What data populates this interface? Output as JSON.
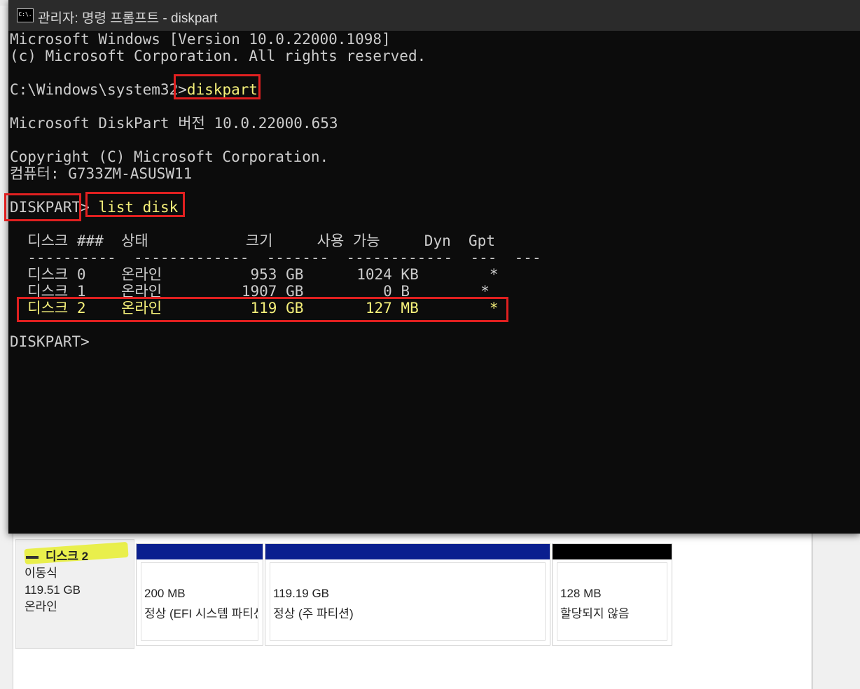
{
  "cmd": {
    "title": "관리자: 명령 프롬프트 - diskpart",
    "icon": "cmd-icon",
    "icon_text": "C:\\.",
    "lines": [
      "Microsoft Windows [Version 10.0.22000.1098]",
      "(c) Microsoft Corporation. All rights reserved.",
      "",
      "C:\\Windows\\system32>",
      "",
      "Microsoft DiskPart 버전 10.0.22000.653",
      "",
      "Copyright (C) Microsoft Corporation.",
      "컴퓨터: G733ZM-ASUSW11",
      "",
      "DISKPART>",
      "",
      "  디스크 ###  상태           크기     사용 가능     Dyn  Gpt",
      "  ----------  -------------  -------  ------------  ---  ---",
      "  디스크 0    온라인          953 GB      1024 KB        *",
      "  디스크 1    온라인         1907 GB         0 B        *",
      "  디스크 2    온라인          119 GB       127 MB        *",
      "",
      "DISKPART>"
    ],
    "command1": "diskpart",
    "command2": " list disk",
    "highlight_color": "#e02020",
    "text_color": "#cccccc",
    "selected_text_color": "#f5f07a"
  },
  "disk_mgmt": {
    "disk_name": "디스크 2",
    "disk_type": "이동식",
    "disk_size": "119.51 GB",
    "disk_status": "온라인",
    "partitions": [
      {
        "size": "200 MB",
        "desc": "정상 (EFI 시스템 파티션)",
        "bar_color": "#0a1f8f"
      },
      {
        "size": "119.19 GB",
        "desc": "정상 (주 파티션)",
        "bar_color": "#0a1f8f"
      },
      {
        "size": "128 MB",
        "desc": "할당되지 않음",
        "bar_color": "#000000"
      }
    ]
  }
}
